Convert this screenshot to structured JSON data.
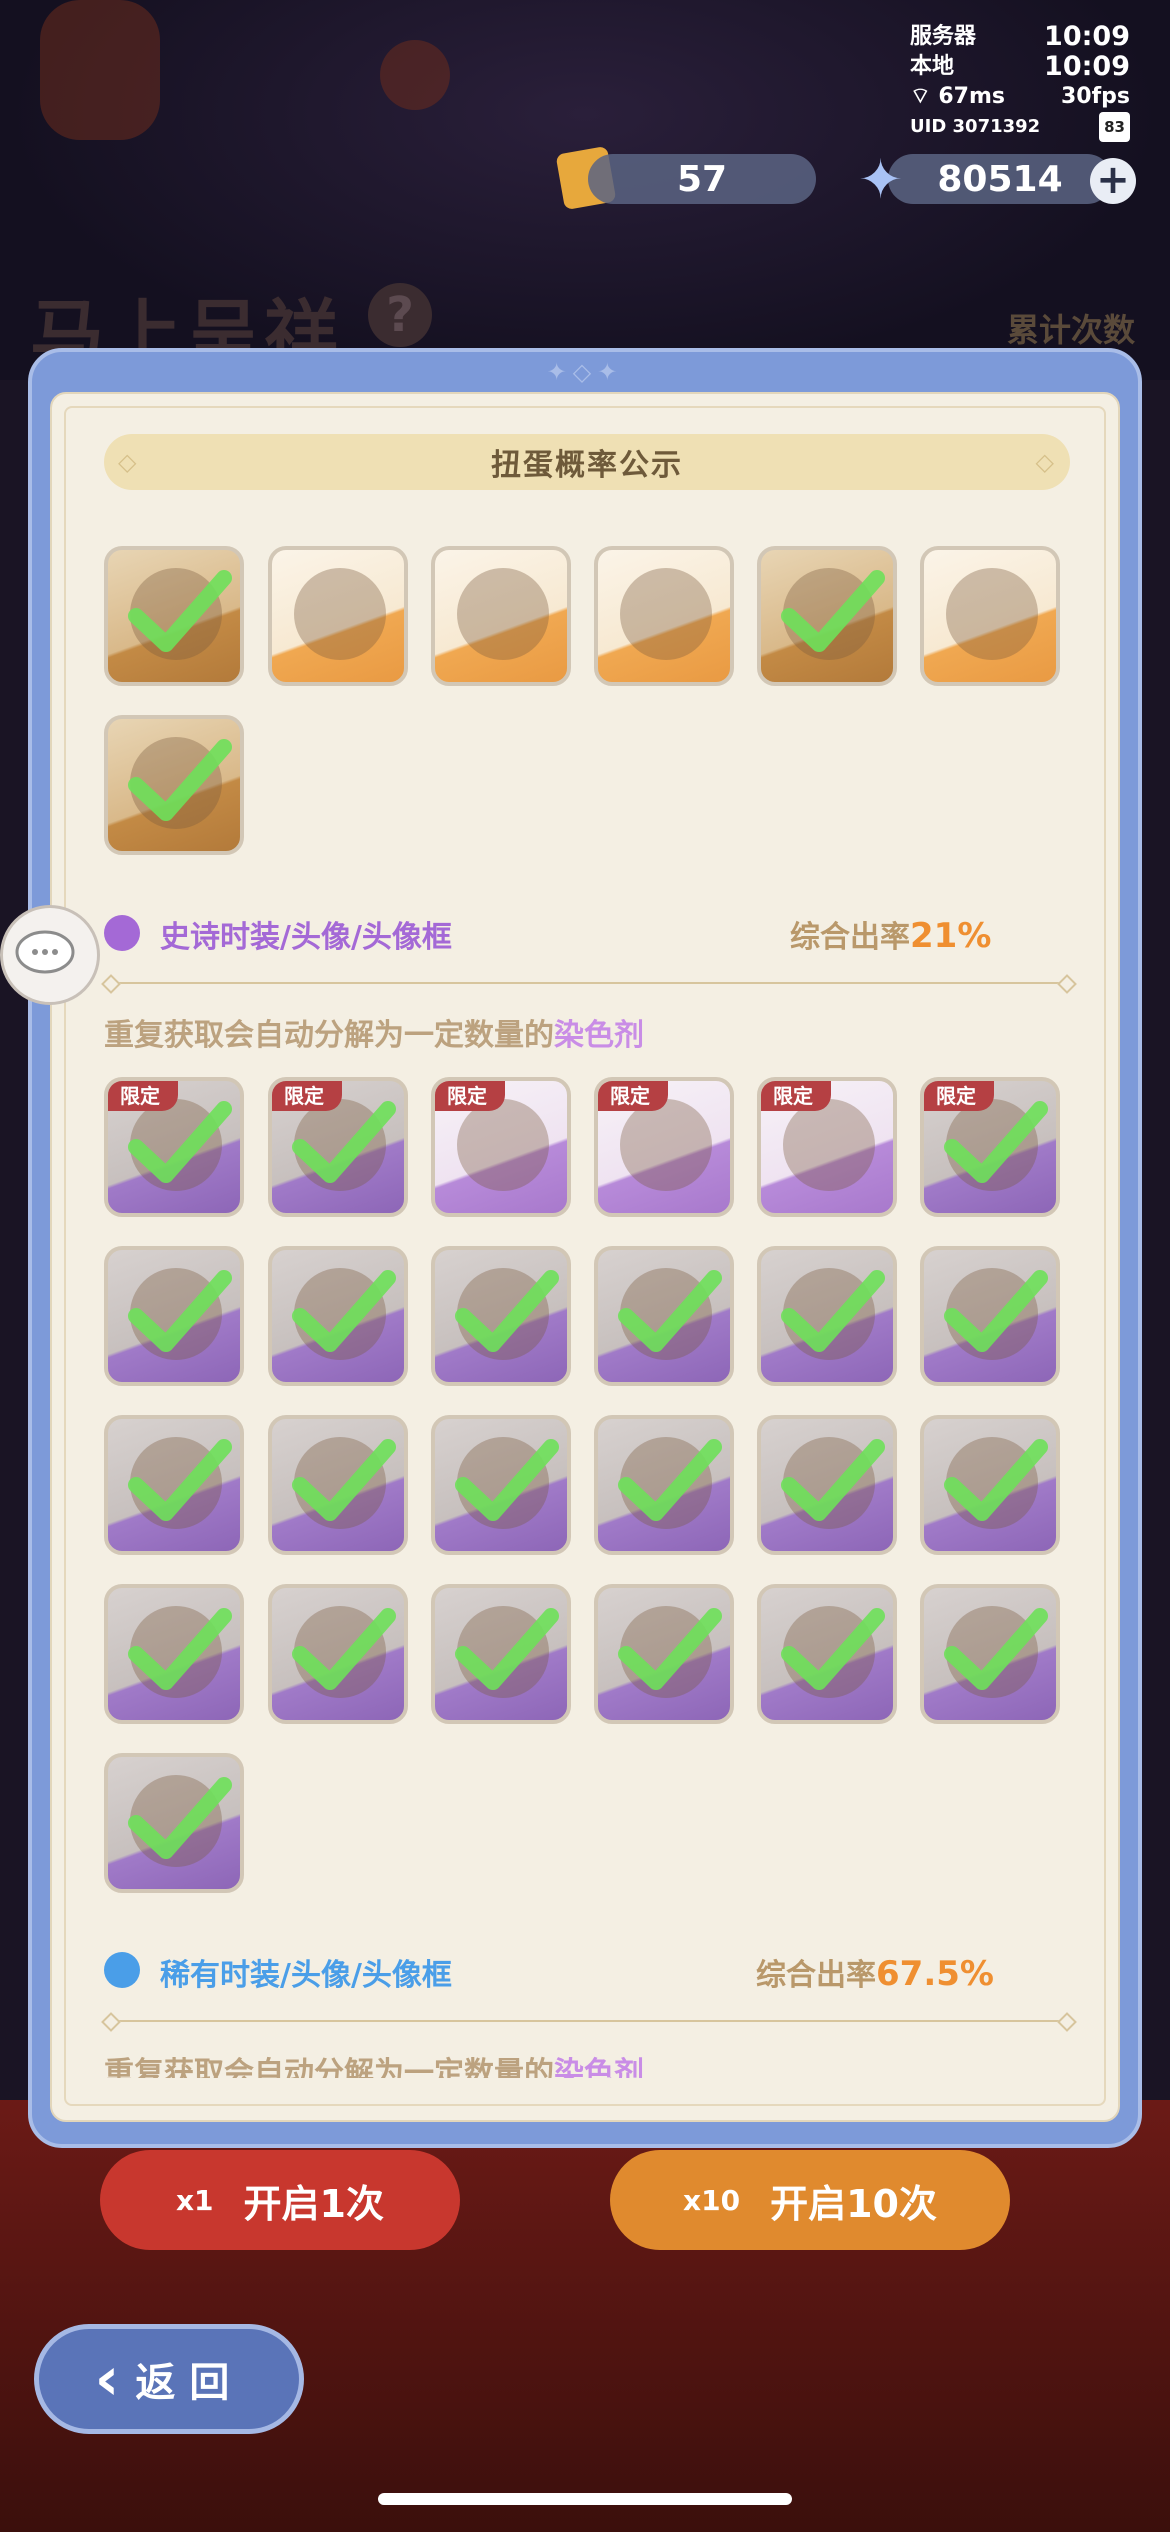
{
  "status": {
    "server_label": "服务器",
    "server_time": "10:09",
    "local_label": "本地",
    "local_time": "10:09",
    "ping": "67ms",
    "fps": "30fps",
    "uid": "UID 3071392",
    "battery": "83"
  },
  "currency": {
    "tickets": "57",
    "crystals": "80514"
  },
  "background": {
    "event_title": "马上呈祥",
    "help": "?",
    "cumulative": "累计次数",
    "open_once": "开启1次",
    "open_ten": "开启10次",
    "once_count": "x1",
    "ten_count": "x10"
  },
  "modal": {
    "title": "扭蛋概率公示",
    "epic": {
      "title": "史诗时装/头像/头像框",
      "rate_label": "综合出率",
      "rate": "21%",
      "note_prefix": "重复获取会自动分解为一定数量的",
      "note_highlight": "染色剂"
    },
    "rare": {
      "title": "稀有时装/头像/头像框",
      "rate_label": "综合出率",
      "rate": "67.5%",
      "note_prefix": "重复获取会自动分解为一定数量的",
      "note_highlight": "染色剂"
    },
    "limited_tag": "限定"
  },
  "nav": {
    "back": "返回"
  },
  "colors": {
    "accent_orange": "#ef8f31",
    "epic_purple": "#a469d6",
    "rare_blue": "#4a9ee8",
    "check_green": "#6ee05a"
  }
}
